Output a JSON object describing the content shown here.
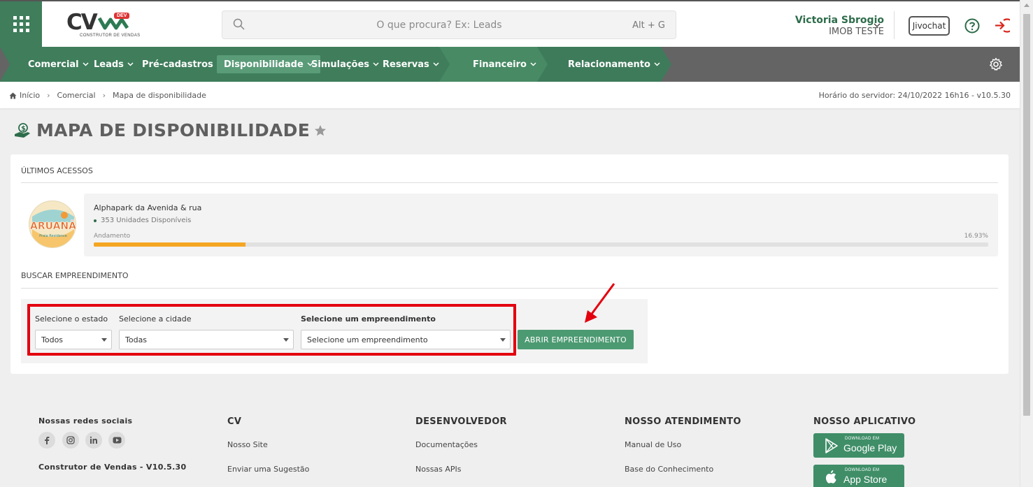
{
  "header": {
    "logo_text": "CV",
    "logo_badge": "DEV",
    "logo_subtitle": "CONSTRUTOR DE VENDAS",
    "search_placeholder": "O que procura? Ex: Leads",
    "search_shortcut": "Alt + G",
    "user_name": "Victoria Sbrogio",
    "user_company": "IMOB TESTE",
    "jivochat_label": "Jivochat"
  },
  "nav": {
    "items": [
      {
        "label": "Comercial"
      },
      {
        "label": "Leads"
      },
      {
        "label": "Pré-cadastros"
      },
      {
        "label": "Disponibilidade"
      },
      {
        "label": "Simulações"
      },
      {
        "label": "Reservas"
      },
      {
        "label": "Financeiro"
      },
      {
        "label": "Relacionamento"
      }
    ],
    "active": "Disponibilidade",
    "colors": {
      "segment_1": "#3f7d5b",
      "segment_2": "#478a64",
      "segment_3": "#3e7b5a",
      "active_item": "#5a9b78"
    }
  },
  "breadcrumb": {
    "home": "Início",
    "level1": "Comercial",
    "level2": "Mapa de disponibilidade",
    "server_time": "Horário do servidor: 24/10/2022 16h16 - v10.5.30"
  },
  "page": {
    "title": "MAPA DE DISPONIBILIDADE"
  },
  "recent": {
    "heading": "ÚLTIMOS ACESSOS",
    "item": {
      "name": "Alphapark da Avenida & rua",
      "units": "353 Unidades Disponíveis",
      "progress_label": "Andamento",
      "progress_text": "16.93%",
      "progress_value": 0.1693,
      "logo_text": "ARUANÃ",
      "logo_sub": "Praia Residence"
    }
  },
  "search_section": {
    "heading": "BUSCAR EMPREENDIMENTO",
    "state_label": "Selecione o estado",
    "state_value": "Todos",
    "city_label": "Selecione a cidade",
    "city_value": "Todas",
    "project_label": "Selecione um empreendimento",
    "project_value": "Selecione um empreendimento",
    "open_button": "ABRIR EMPREENDIMENTO",
    "annotation_color": "#e3000f"
  },
  "footer": {
    "social_heading": "Nossas redes sociais",
    "version": "Construtor de Vendas - V10.5.30",
    "cv_heading": "CV",
    "cv_links": [
      "Nosso Site",
      "Enviar uma Sugestão"
    ],
    "dev_heading": "DESENVOLVEDOR",
    "dev_links": [
      "Documentações",
      "Nossas APIs"
    ],
    "support_heading": "NOSSO ATENDIMENTO",
    "support_links": [
      "Manual de Uso",
      "Base do Conhecimento"
    ],
    "app_heading": "NOSSO APLICATIVO",
    "google_play_small": "DOWNLOAD EM",
    "google_play_big": "Google Play",
    "app_store_small": "DOWNLOAD EM",
    "app_store_big": "App Store"
  }
}
